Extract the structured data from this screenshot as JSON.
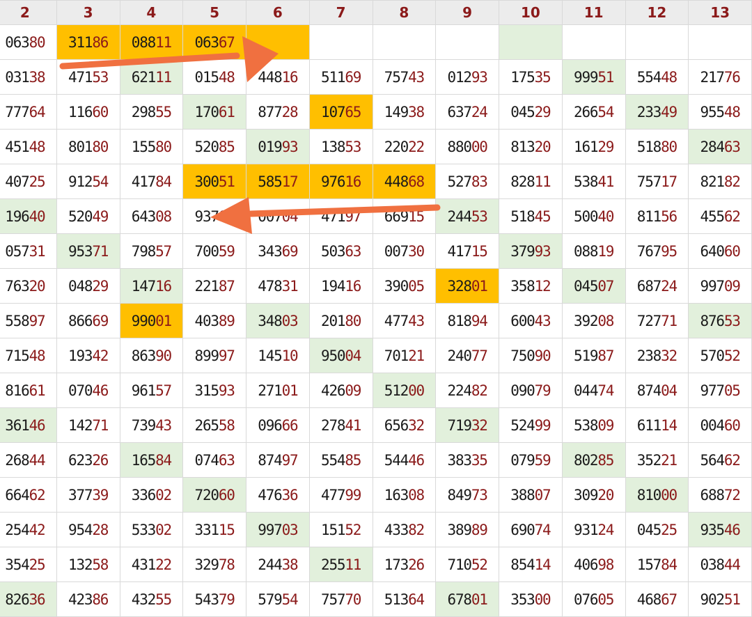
{
  "columns": [
    "2",
    "3",
    "4",
    "5",
    "6",
    "7",
    "8",
    "9",
    "10",
    "11",
    "12",
    "13"
  ],
  "colors": {
    "highlight_green": "#e2f0dc",
    "highlight_orange": "#ffbf00",
    "digit_accent": "#8b1a1a",
    "arrow": "#f07040"
  },
  "annotations": [
    {
      "name": "arrow-right",
      "direction": "right"
    },
    {
      "name": "arrow-left",
      "direction": "left"
    }
  ],
  "rows": [
    {
      "cells": [
        {
          "t": "06380"
        },
        {
          "t": "31186",
          "h": "orange"
        },
        {
          "t": "08811",
          "h": "orange"
        },
        {
          "t": "06367",
          "h": "orange"
        },
        {
          "t": "",
          "h": "orange"
        },
        {
          "t": ""
        },
        {
          "t": ""
        },
        {
          "t": ""
        },
        {
          "t": "",
          "h": "green"
        },
        {
          "t": ""
        },
        {
          "t": ""
        },
        {
          "t": ""
        }
      ]
    },
    {
      "cells": [
        {
          "t": "03138"
        },
        {
          "t": "47153"
        },
        {
          "t": "62111",
          "h": "green"
        },
        {
          "t": "01548"
        },
        {
          "t": "44816"
        },
        {
          "t": "51169"
        },
        {
          "t": "75743"
        },
        {
          "t": "01293"
        },
        {
          "t": "17535"
        },
        {
          "t": "99951",
          "h": "green"
        },
        {
          "t": "55448"
        },
        {
          "t": "21776"
        }
      ]
    },
    {
      "cells": [
        {
          "t": "77764"
        },
        {
          "t": "11660"
        },
        {
          "t": "29855"
        },
        {
          "t": "17061",
          "h": "green"
        },
        {
          "t": "87728"
        },
        {
          "t": "10765",
          "h": "orange"
        },
        {
          "t": "14938"
        },
        {
          "t": "63724"
        },
        {
          "t": "04529"
        },
        {
          "t": "26654"
        },
        {
          "t": "23349",
          "h": "green"
        },
        {
          "t": "95548"
        }
      ]
    },
    {
      "cells": [
        {
          "t": "45148"
        },
        {
          "t": "80180"
        },
        {
          "t": "15580"
        },
        {
          "t": "52085"
        },
        {
          "t": "01993",
          "h": "green"
        },
        {
          "t": "13853"
        },
        {
          "t": "22022"
        },
        {
          "t": "88000"
        },
        {
          "t": "81320"
        },
        {
          "t": "16129"
        },
        {
          "t": "51880"
        },
        {
          "t": "28463",
          "h": "green"
        }
      ]
    },
    {
      "cells": [
        {
          "t": "40725"
        },
        {
          "t": "91254"
        },
        {
          "t": "41784"
        },
        {
          "t": "30051",
          "h": "orange"
        },
        {
          "t": "58517",
          "h": "orange"
        },
        {
          "t": "97616",
          "h": "orange"
        },
        {
          "t": "44868",
          "h": "orange"
        },
        {
          "t": "52783"
        },
        {
          "t": "82811"
        },
        {
          "t": "53841"
        },
        {
          "t": "75717"
        },
        {
          "t": "82182"
        }
      ]
    },
    {
      "cells": [
        {
          "t": "19640",
          "h": "green"
        },
        {
          "t": "52049"
        },
        {
          "t": "64308"
        },
        {
          "t": "93707"
        },
        {
          "t": "00704"
        },
        {
          "t": "47197"
        },
        {
          "t": "66915"
        },
        {
          "t": "24453",
          "h": "green"
        },
        {
          "t": "51845"
        },
        {
          "t": "50040"
        },
        {
          "t": "81156"
        },
        {
          "t": "45562"
        }
      ]
    },
    {
      "cells": [
        {
          "t": "05731"
        },
        {
          "t": "95371",
          "h": "green"
        },
        {
          "t": "79857"
        },
        {
          "t": "70059"
        },
        {
          "t": "34369"
        },
        {
          "t": "50363"
        },
        {
          "t": "00730"
        },
        {
          "t": "41715"
        },
        {
          "t": "37993",
          "h": "green"
        },
        {
          "t": "08819"
        },
        {
          "t": "76795"
        },
        {
          "t": "64060"
        }
      ]
    },
    {
      "cells": [
        {
          "t": "76320"
        },
        {
          "t": "04829"
        },
        {
          "t": "14716",
          "h": "green"
        },
        {
          "t": "22187"
        },
        {
          "t": "47831"
        },
        {
          "t": "19416"
        },
        {
          "t": "39005"
        },
        {
          "t": "32801",
          "h": "orange"
        },
        {
          "t": "35812"
        },
        {
          "t": "04507",
          "h": "green"
        },
        {
          "t": "68724"
        },
        {
          "t": "99709"
        }
      ]
    },
    {
      "cells": [
        {
          "t": "55897"
        },
        {
          "t": "86669"
        },
        {
          "t": "99001",
          "h": "orange"
        },
        {
          "t": "40389"
        },
        {
          "t": "34803",
          "h": "green"
        },
        {
          "t": "20180"
        },
        {
          "t": "47743"
        },
        {
          "t": "81894"
        },
        {
          "t": "60043"
        },
        {
          "t": "39208"
        },
        {
          "t": "72771"
        },
        {
          "t": "87653",
          "h": "green"
        }
      ]
    },
    {
      "cells": [
        {
          "t": "71548"
        },
        {
          "t": "19342"
        },
        {
          "t": "86390"
        },
        {
          "t": "89997"
        },
        {
          "t": "14510"
        },
        {
          "t": "95004",
          "h": "green"
        },
        {
          "t": "70121"
        },
        {
          "t": "24077"
        },
        {
          "t": "75090"
        },
        {
          "t": "51987"
        },
        {
          "t": "23832"
        },
        {
          "t": "57052"
        }
      ]
    },
    {
      "cells": [
        {
          "t": "81661"
        },
        {
          "t": "07046"
        },
        {
          "t": "96157"
        },
        {
          "t": "31593"
        },
        {
          "t": "27101"
        },
        {
          "t": "42609"
        },
        {
          "t": "51200",
          "h": "green"
        },
        {
          "t": "22482"
        },
        {
          "t": "09079"
        },
        {
          "t": "04474"
        },
        {
          "t": "87404"
        },
        {
          "t": "97705"
        }
      ]
    },
    {
      "cells": [
        {
          "t": "36146",
          "h": "green"
        },
        {
          "t": "14271"
        },
        {
          "t": "73943"
        },
        {
          "t": "26558"
        },
        {
          "t": "09666"
        },
        {
          "t": "27841"
        },
        {
          "t": "65632"
        },
        {
          "t": "71932",
          "h": "green"
        },
        {
          "t": "52499"
        },
        {
          "t": "53809"
        },
        {
          "t": "61114"
        },
        {
          "t": "00460"
        }
      ]
    },
    {
      "cells": [
        {
          "t": "26844"
        },
        {
          "t": "62326"
        },
        {
          "t": "16584",
          "h": "green"
        },
        {
          "t": "07463"
        },
        {
          "t": "87497"
        },
        {
          "t": "55485"
        },
        {
          "t": "54446"
        },
        {
          "t": "38335"
        },
        {
          "t": "07959"
        },
        {
          "t": "80285",
          "h": "green"
        },
        {
          "t": "35221"
        },
        {
          "t": "56462"
        }
      ]
    },
    {
      "cells": [
        {
          "t": "66462"
        },
        {
          "t": "37739"
        },
        {
          "t": "33602"
        },
        {
          "t": "72060",
          "h": "green"
        },
        {
          "t": "47636"
        },
        {
          "t": "47799"
        },
        {
          "t": "16308"
        },
        {
          "t": "84973"
        },
        {
          "t": "38807"
        },
        {
          "t": "30920"
        },
        {
          "t": "81000",
          "h": "green"
        },
        {
          "t": "68872"
        }
      ]
    },
    {
      "cells": [
        {
          "t": "25442"
        },
        {
          "t": "95428"
        },
        {
          "t": "53302"
        },
        {
          "t": "33115"
        },
        {
          "t": "99703",
          "h": "green"
        },
        {
          "t": "15152"
        },
        {
          "t": "43382"
        },
        {
          "t": "38989"
        },
        {
          "t": "69074"
        },
        {
          "t": "93124"
        },
        {
          "t": "04525"
        },
        {
          "t": "93546",
          "h": "green"
        }
      ]
    },
    {
      "cells": [
        {
          "t": "35425"
        },
        {
          "t": "13258"
        },
        {
          "t": "43122"
        },
        {
          "t": "32978"
        },
        {
          "t": "24438"
        },
        {
          "t": "25511",
          "h": "green"
        },
        {
          "t": "17326"
        },
        {
          "t": "71052"
        },
        {
          "t": "85414"
        },
        {
          "t": "40698"
        },
        {
          "t": "15784"
        },
        {
          "t": "03844"
        }
      ]
    },
    {
      "cells": [
        {
          "t": "82636",
          "h": "green"
        },
        {
          "t": "42386"
        },
        {
          "t": "43255"
        },
        {
          "t": "54379"
        },
        {
          "t": "57954"
        },
        {
          "t": "75770"
        },
        {
          "t": "51364"
        },
        {
          "t": "67801",
          "h": "green"
        },
        {
          "t": "35300"
        },
        {
          "t": "07605"
        },
        {
          "t": "46867"
        },
        {
          "t": "90251"
        }
      ]
    }
  ]
}
